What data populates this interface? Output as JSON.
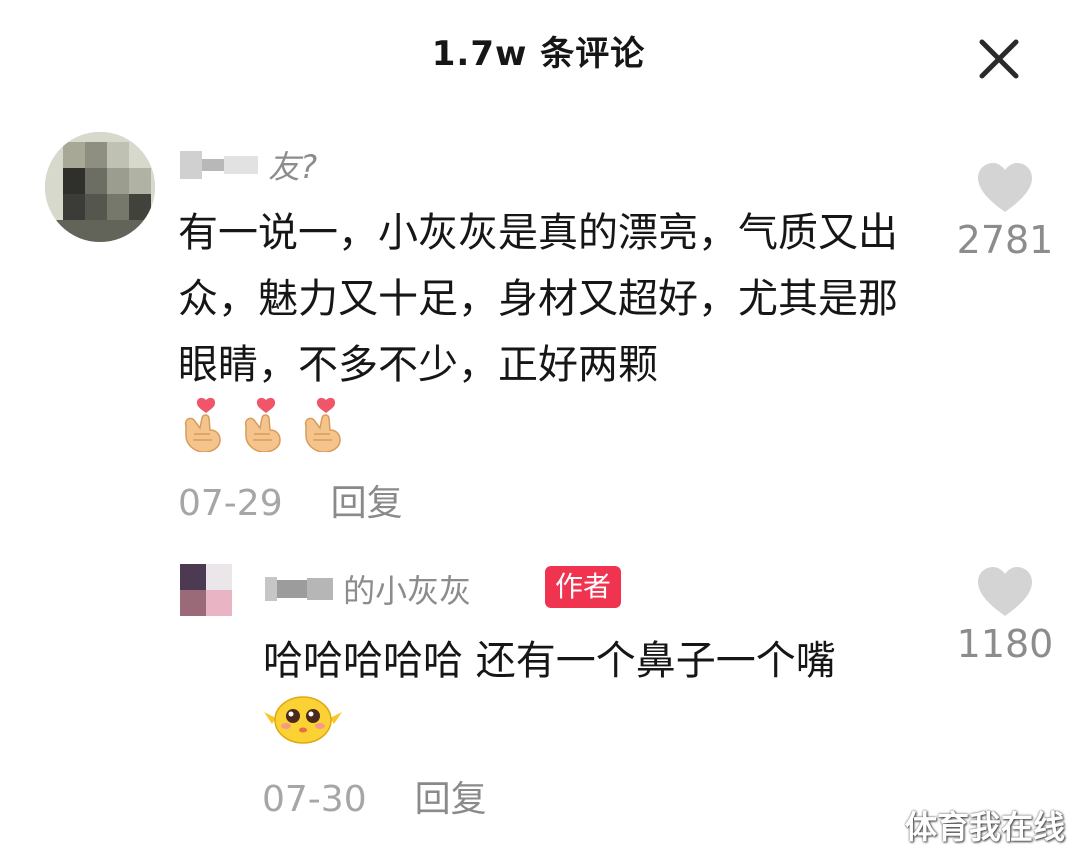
{
  "header": {
    "title": "1.7w 条评论"
  },
  "comments": [
    {
      "username_visible": "友?",
      "text": "有一说一，小灰灰是真的漂亮，气质又出众，魅力又十足，身材又超好，尤其是那眼睛，不多不少，正好两颗",
      "emoji": [
        "finger-heart-emoji",
        "finger-heart-emoji",
        "finger-heart-emoji"
      ],
      "date": "07-29",
      "reply_label": "回复",
      "like_count": "2781"
    },
    {
      "username_visible": "的小灰灰",
      "badge": "作者",
      "text": "哈哈哈哈哈 还有一个鼻子一个嘴",
      "emoji": [
        "pleading-chick-emoji"
      ],
      "date": "07-30",
      "reply_label": "回复",
      "like_count": "1180"
    }
  ],
  "watermark": "体育我在线",
  "colors": {
    "badge_bg": "#f0344f",
    "like_icon": "#d4d4d4",
    "meta_text": "#a6a6a6"
  }
}
